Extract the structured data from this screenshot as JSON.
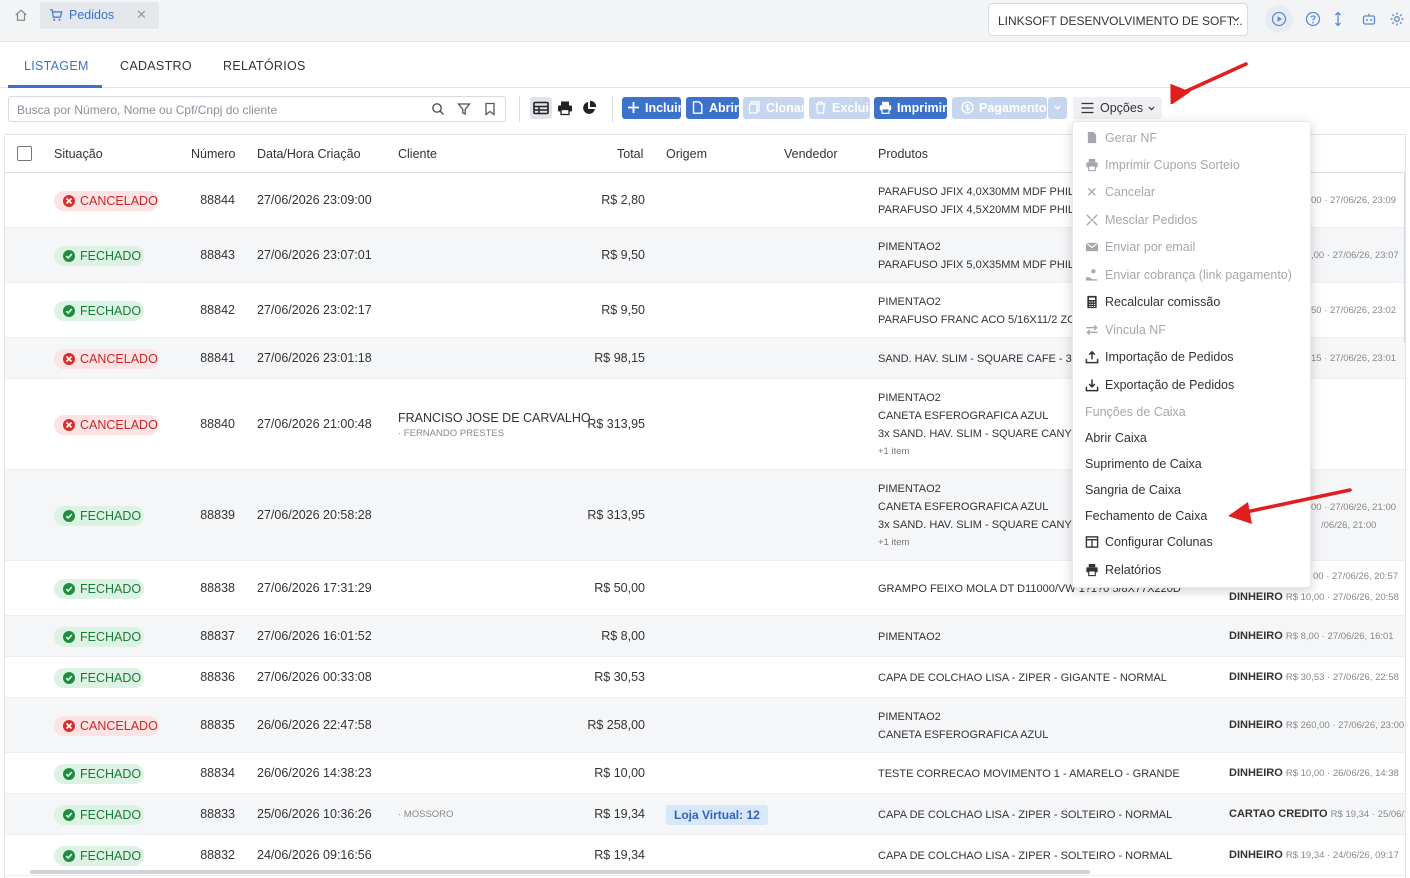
{
  "topbar": {
    "tab_label": "Pedidos",
    "company": "LINKSOFT DESENVOLVIMENTO DE SOFT..."
  },
  "nav": {
    "tabs": [
      "LISTAGEM",
      "CADASTRO",
      "RELATÓRIOS"
    ]
  },
  "search": {
    "placeholder": "Busca por Número, Nome ou Cpf/Cnpj do cliente"
  },
  "actions": {
    "incluir": "Incluir",
    "abrir": "Abrir",
    "clonar": "Clonar",
    "excluir": "Excluir",
    "imprimir": "Imprimir",
    "pagamento": "Pagamento",
    "opcoes": "Opções"
  },
  "table": {
    "headers": [
      "Situação",
      "Número",
      "Data/Hora Criação",
      "Cliente",
      "Total",
      "Origem",
      "Vendedor",
      "Produtos"
    ],
    "rows": [
      {
        "status": "CANCELADO",
        "numero": "88844",
        "data": "27/06/2026 23:09:00",
        "cliente": "",
        "cliente_sub": "",
        "total": "R$ 2,80",
        "origem": "",
        "produtos": [
          "PARAFUSO JFIX 4,0X30MM MDF PHIL JC",
          "PARAFUSO JFIX 4,5X20MM MDF PHIL JC"
        ],
        "mais": "",
        "pag_tipo": "",
        "pag_det": "00 · 27/06/26, 23:09",
        "pag_det2": ""
      },
      {
        "status": "FECHADO",
        "numero": "88843",
        "data": "27/06/2026 23:07:01",
        "cliente": "",
        "cliente_sub": "",
        "total": "R$ 9,50",
        "origem": "",
        "produtos": [
          "PIMENTAO2",
          "PARAFUSO JFIX 5,0X35MM MDF PHIL JC"
        ],
        "mais": "",
        "pag_tipo": "",
        "pag_det": ",00 · 27/06/26, 23:07",
        "pag_det2": ""
      },
      {
        "status": "FECHADO",
        "numero": "88842",
        "data": "27/06/2026 23:02:17",
        "cliente": "",
        "cliente_sub": "",
        "total": "R$ 9,50",
        "origem": "",
        "produtos": [
          "PIMENTAO2",
          "PARAFUSO FRANC ACO 5/16X11/2 ZC JC"
        ],
        "mais": "",
        "pag_tipo": "",
        "pag_det": "50 · 27/06/26, 23:02",
        "pag_det2": ""
      },
      {
        "status": "CANCELADO",
        "numero": "88841",
        "data": "27/06/2026 23:01:18",
        "cliente": "",
        "cliente_sub": "",
        "total": "R$ 98,15",
        "origem": "",
        "produtos": [
          "SAND. HAV. SLIM - SQUARE CAFE - 35/36"
        ],
        "mais": "",
        "pag_tipo": "",
        "pag_det": "15 · 27/06/26, 23:01",
        "pag_det2": ""
      },
      {
        "status": "CANCELADO",
        "numero": "88840",
        "data": "27/06/2026 21:00:48",
        "cliente": "FRANCISO JOSE DE CARVALHO",
        "cliente_sub": "· FERNANDO PRESTES",
        "total": "R$ 313,95",
        "origem": "",
        "produtos": [
          "PIMENTAO2",
          "CANETA ESFEROGRAFICA AZUL",
          "3x SAND. HAV. SLIM - SQUARE CANYON"
        ],
        "mais": "+1 item",
        "pag_tipo": "",
        "pag_det": "",
        "pag_det2": ""
      },
      {
        "status": "FECHADO",
        "numero": "88839",
        "data": "27/06/2026 20:58:28",
        "cliente": "",
        "cliente_sub": "",
        "total": "R$ 313,95",
        "origem": "",
        "produtos": [
          "PIMENTAO2",
          "CANETA ESFEROGRAFICA AZUL",
          "3x SAND. HAV. SLIM - SQUARE CANYON"
        ],
        "mais": "+1 item",
        "pag_tipo": "",
        "pag_det": "00 · 27/06/26, 21:00",
        "pag_det2": "/06/26, 21:00"
      },
      {
        "status": "FECHADO",
        "numero": "88838",
        "data": "27/06/2026 17:31:29",
        "cliente": "",
        "cliente_sub": "",
        "total": "R$ 50,00",
        "origem": "",
        "produtos": [
          "GRAMPO FEIXO MOLA DT D11000/VW 1?1?0 5/8X77X220D"
        ],
        "mais": "",
        "pag_tipo": "DINHEIRO",
        "pag_det": "R$ 10,00 · 27/06/26, 20:58",
        "pag_det2": "00 · 27/06/26, 20:57"
      },
      {
        "status": "FECHADO",
        "numero": "88837",
        "data": "27/06/2026 16:01:52",
        "cliente": "",
        "cliente_sub": "",
        "total": "R$ 8,00",
        "origem": "",
        "produtos": [
          "PIMENTAO2"
        ],
        "mais": "",
        "pag_tipo": "DINHEIRO",
        "pag_det": "R$ 8,00 · 27/06/26, 16:01",
        "pag_det2": ""
      },
      {
        "status": "FECHADO",
        "numero": "88836",
        "data": "27/06/2026 00:33:08",
        "cliente": "",
        "cliente_sub": "",
        "total": "R$ 30,53",
        "origem": "",
        "produtos": [
          "CAPA DE COLCHAO LISA - ZIPER - GIGANTE - NORMAL"
        ],
        "mais": "",
        "pag_tipo": "DINHEIRO",
        "pag_det": "R$ 30,53 · 27/06/26, 22:58",
        "pag_det2": ""
      },
      {
        "status": "CANCELADO",
        "numero": "88835",
        "data": "26/06/2026 22:47:58",
        "cliente": "",
        "cliente_sub": "",
        "total": "R$ 258,00",
        "origem": "",
        "produtos": [
          "PIMENTAO2",
          "CANETA ESFEROGRAFICA AZUL"
        ],
        "mais": "",
        "pag_tipo": "DINHEIRO",
        "pag_det": "R$ 260,00 · 27/06/26, 23:00",
        "pag_det2": ""
      },
      {
        "status": "FECHADO",
        "numero": "88834",
        "data": "26/06/2026 14:38:23",
        "cliente": "",
        "cliente_sub": "",
        "total": "R$ 10,00",
        "origem": "",
        "produtos": [
          "TESTE CORRECAO MOVIMENTO 1 - AMARELO - GRANDE"
        ],
        "mais": "",
        "pag_tipo": "DINHEIRO",
        "pag_det": "R$ 10,00 · 26/06/26, 14:38",
        "pag_det2": ""
      },
      {
        "status": "FECHADO",
        "numero": "88833",
        "data": "25/06/2026 10:36:26",
        "cliente": "",
        "cliente_sub": "· MOSSORO",
        "total": "R$ 19,34",
        "origem": "Loja Virtual: 12",
        "produtos": [
          "CAPA DE COLCHAO LISA - ZIPER - SOLTEIRO - NORMAL"
        ],
        "mais": "",
        "pag_tipo": "CARTAO CREDITO",
        "pag_det": "R$ 19,34 · 25/06/26",
        "pag_det2": ""
      },
      {
        "status": "FECHADO",
        "numero": "88832",
        "data": "24/06/2026 09:16:56",
        "cliente": "",
        "cliente_sub": "",
        "total": "R$ 19,34",
        "origem": "",
        "produtos": [
          "CAPA DE COLCHAO LISA - ZIPER - SOLTEIRO - NORMAL"
        ],
        "mais": "",
        "pag_tipo": "DINHEIRO",
        "pag_det": "R$ 19,34 · 24/06/26, 09:17",
        "pag_det2": ""
      }
    ]
  },
  "menu": {
    "items": [
      {
        "label": "Gerar NF",
        "icon": "document-icon",
        "enabled": false
      },
      {
        "label": "Imprimir Cupons Sorteio",
        "icon": "printer-icon",
        "enabled": false
      },
      {
        "label": "Cancelar",
        "icon": "close-icon",
        "enabled": false
      },
      {
        "label": "Mesclar Pedidos",
        "icon": "merge-icon",
        "enabled": false
      },
      {
        "label": "Enviar por email",
        "icon": "envelope-icon",
        "enabled": false
      },
      {
        "label": "Enviar cobrança (link pagamento)",
        "icon": "hand-money-icon",
        "enabled": false
      },
      {
        "label": "Recalcular comissão",
        "icon": "calculator-icon",
        "enabled": true
      },
      {
        "label": "Vincula NF",
        "icon": "exchange-icon",
        "enabled": false
      },
      {
        "label": "Importação de Pedidos",
        "icon": "upload-icon",
        "enabled": true
      },
      {
        "label": "Exportação de Pedidos",
        "icon": "download-icon",
        "enabled": true
      },
      {
        "label": "Funções de Caixa",
        "icon": "",
        "enabled": false,
        "section": true
      },
      {
        "label": "Abrir Caixa",
        "icon": "",
        "enabled": true
      },
      {
        "label": "Suprimento de Caixa",
        "icon": "",
        "enabled": true
      },
      {
        "label": "Sangria de Caixa",
        "icon": "",
        "enabled": true
      },
      {
        "label": "Fechamento de Caixa",
        "icon": "",
        "enabled": true
      },
      {
        "label": "Configurar Colunas",
        "icon": "columns-icon",
        "enabled": true
      },
      {
        "label": "Relatórios",
        "icon": "printer-icon",
        "enabled": true
      }
    ]
  },
  "colors": {
    "primary": "#3c72c9",
    "cancel": "#c62828",
    "closed": "#1b7a3a",
    "annotation_arrow": "#e01e1e"
  }
}
